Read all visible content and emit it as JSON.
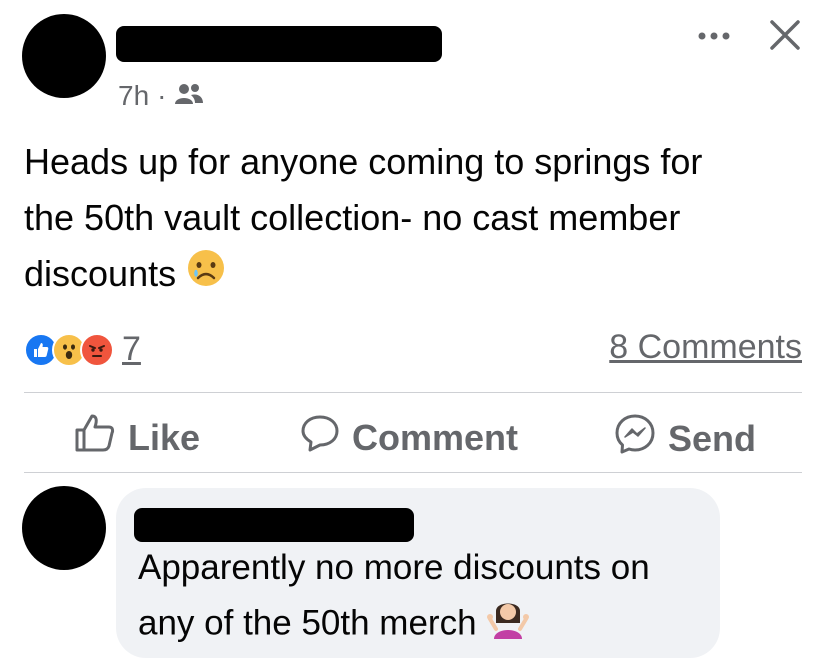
{
  "post": {
    "time": "7h",
    "separator": "·",
    "audience_icon": "friends-icon",
    "text_line1": "Heads up for anyone coming to springs for",
    "text_line2": "the 50th vault collection- no cast member",
    "text_line3": "discounts",
    "text_emoji": "crying-face-emoji"
  },
  "reactions": {
    "icons": [
      "like-reaction-icon",
      "wow-reaction-icon",
      "angry-reaction-icon"
    ],
    "count": "7"
  },
  "comments_link": "8 Comments",
  "actions": {
    "like": "Like",
    "comment": "Comment",
    "send": "Send"
  },
  "comment": {
    "line1": "Apparently no more discounts on",
    "line2": "any of the 50th merch",
    "emoji": "woman-shrugging-emoji"
  },
  "colors": {
    "secondary_text": "#65676b",
    "like_blue": "#1877f2",
    "angry_red": "#f0553d",
    "wow_yellow": "#f7c04a",
    "bubble_bg": "#f0f2f5"
  }
}
